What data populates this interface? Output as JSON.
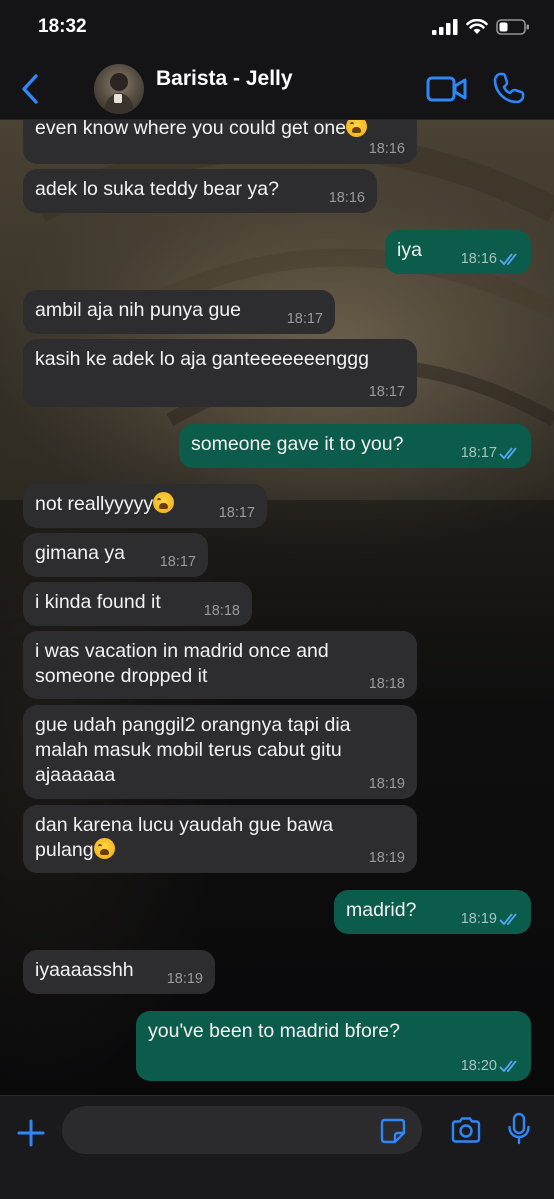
{
  "status_bar": {
    "time": "18:32"
  },
  "header": {
    "contact_name": "Barista - Jelly"
  },
  "messages": [
    {
      "dir": "in",
      "text": "even know where you could get one",
      "emoji": true,
      "time": "18:16"
    },
    {
      "dir": "in",
      "text": "adek lo suka teddy bear ya?",
      "time": "18:16"
    },
    {
      "dir": "out",
      "text": "iya",
      "time": "18:16",
      "read": true
    },
    {
      "dir": "in",
      "text": "ambil aja nih punya gue",
      "time": "18:17"
    },
    {
      "dir": "in",
      "text": "kasih ke adek lo aja ganteeeeeeenggg",
      "time": "18:17"
    },
    {
      "dir": "out",
      "text": "someone gave it to you?",
      "time": "18:17",
      "read": true
    },
    {
      "dir": "in",
      "text": "not reallyyyyy",
      "emoji": true,
      "time": "18:17"
    },
    {
      "dir": "in",
      "text": "gimana ya",
      "time": "18:17"
    },
    {
      "dir": "in",
      "text": "i kinda found it",
      "time": "18:18"
    },
    {
      "dir": "in",
      "lines": [
        "i was vacation in madrid once and",
        "someone dropped it"
      ],
      "time": "18:18"
    },
    {
      "dir": "in",
      "lines": [
        "gue udah panggil2 orangnya tapi dia",
        "malah masuk mobil terus cabut gitu",
        "ajaaaaaa"
      ],
      "time": "18:19"
    },
    {
      "dir": "in",
      "lines": [
        "dan karena lucu yaudah gue bawa",
        "pulang"
      ],
      "emoji": true,
      "time": "18:19"
    },
    {
      "dir": "out",
      "text": "madrid?",
      "time": "18:19",
      "read": true
    },
    {
      "dir": "in",
      "text": "iyaaaasshh",
      "time": "18:19"
    },
    {
      "dir": "out",
      "text": "you've been to madrid bfore?",
      "time": "18:20",
      "read": true
    }
  ],
  "input": {
    "placeholder": ""
  },
  "colors": {
    "accent": "#2f86f6",
    "incoming": "#2d2d30",
    "outgoing": "#0c5c4c",
    "read_ticks": "#53a8f5"
  }
}
